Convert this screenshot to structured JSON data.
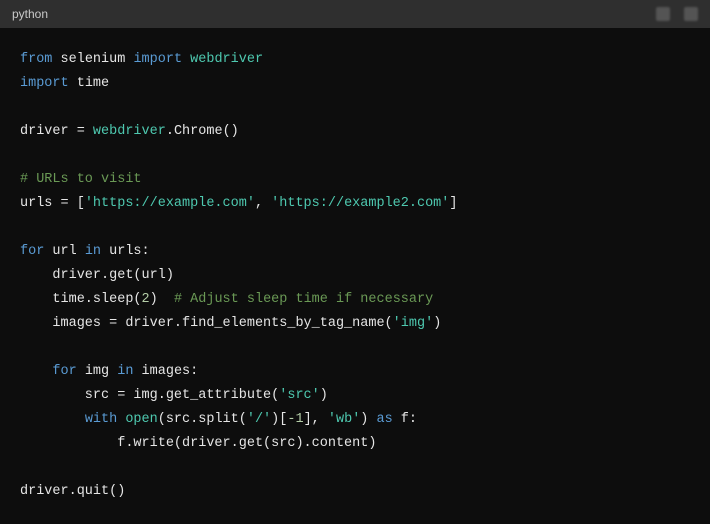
{
  "header": {
    "language": "python"
  },
  "code": {
    "l1_from": "from",
    "l1_sel": "selenium",
    "l1_import": "import",
    "l1_web": "webdriver",
    "l2_import": "import",
    "l2_time": "time",
    "l4_driver": "driver",
    "l4_eq": " = ",
    "l4_web": "webdriver",
    "l4_dot": ".",
    "l4_chrome": "Chrome",
    "l4_parens": "()",
    "l6_cmt": "# URLs to visit",
    "l7_urls": "urls",
    "l7_eq": " = [",
    "l7_s1": "'https://example.com'",
    "l7_comma": ", ",
    "l7_s2": "'https://example2.com'",
    "l7_close": "]",
    "l9_for": "for",
    "l9_url": " url ",
    "l9_in": "in",
    "l9_urls": " urls:",
    "l10_call": "    driver.get(url)",
    "l11_pre": "    time.sleep(",
    "l11_num": "2",
    "l11_post": ")  ",
    "l11_cmt": "# Adjust sleep time if necessary",
    "l12_pre": "    images = driver.find_elements_by_tag_name(",
    "l12_str": "'img'",
    "l12_post": ")",
    "l14_pre": "    ",
    "l14_for": "for",
    "l14_img": " img ",
    "l14_in": "in",
    "l14_images": " images:",
    "l15_pre": "        src = img.get_attribute(",
    "l15_str": "'src'",
    "l15_post": ")",
    "l16_pre": "        ",
    "l16_with": "with",
    "l16_sp1": " ",
    "l16_open": "open",
    "l16_p1": "(src.split(",
    "l16_s1": "'/'",
    "l16_p2": ")[",
    "l16_neg": "-1",
    "l16_p3": "], ",
    "l16_s2": "'wb'",
    "l16_p4": ") ",
    "l16_as": "as",
    "l16_f": " f:",
    "l17": "            f.write(driver.get(src).content)",
    "l19": "driver.quit()"
  }
}
